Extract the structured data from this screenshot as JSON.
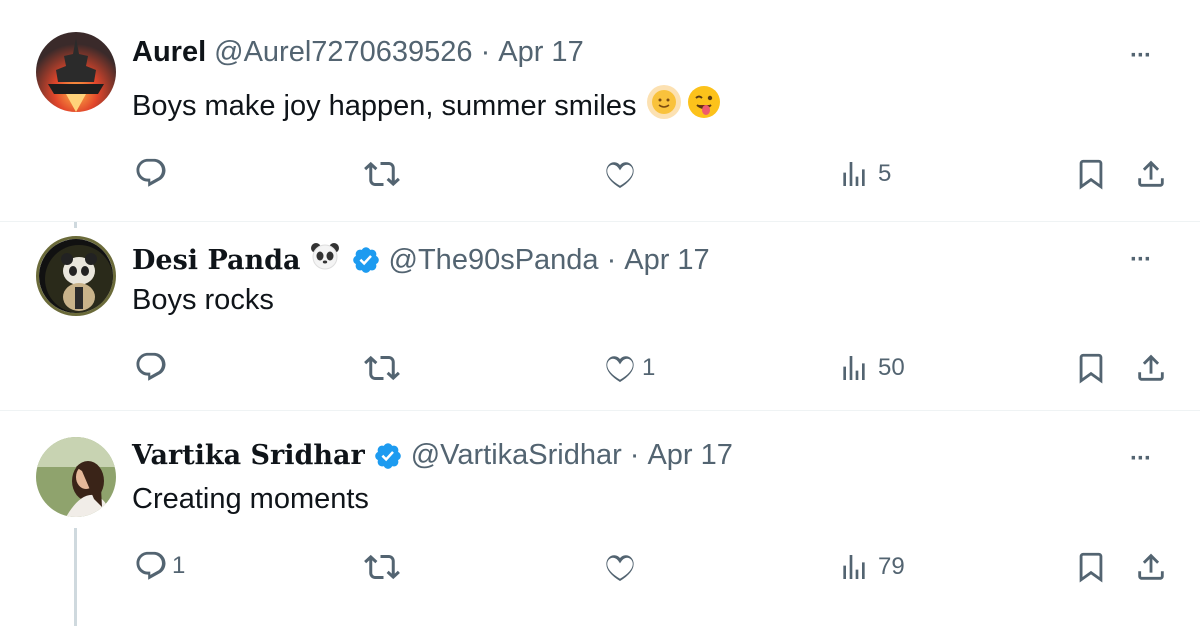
{
  "tweets": [
    {
      "name": "Aurel",
      "handle": "@Aurel7270639526",
      "sep": "·",
      "date": "Apr 17",
      "text": "Boys make joy happen, summer smiles",
      "emojis": [
        "sun-emoji",
        "winking-tongue-emoji"
      ],
      "more": "···",
      "actions": {
        "reply": "",
        "retweet": "",
        "like": "",
        "views": "5"
      }
    },
    {
      "name": "Desi Panda",
      "name_emoji": "panda-face-emoji",
      "verified": true,
      "handle": "@The90sPanda",
      "sep": "·",
      "date": "Apr 17",
      "text": "Boys rocks",
      "more": "···",
      "actions": {
        "reply": "",
        "retweet": "",
        "like": "1",
        "views": "50"
      }
    },
    {
      "name": "Vartika Sridhar",
      "verified": true,
      "handle": "@VartikaSridhar",
      "sep": "·",
      "date": "Apr 17",
      "text": "Creating moments",
      "more": "···",
      "actions": {
        "reply": "1",
        "retweet": "",
        "like": "",
        "views": "79"
      }
    }
  ],
  "colors": {
    "text_primary": "#0f1419",
    "text_secondary": "#536471",
    "verified_blue": "#1d9bf0",
    "divider": "#eff3f4"
  }
}
